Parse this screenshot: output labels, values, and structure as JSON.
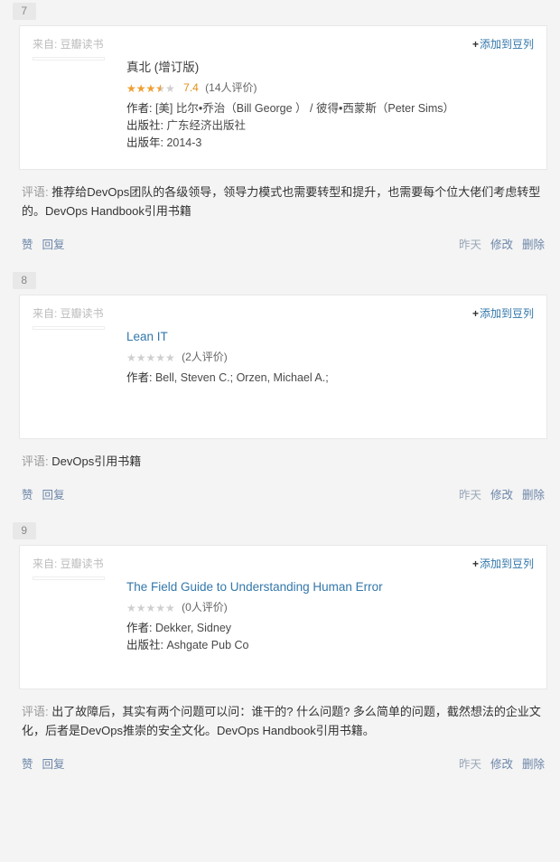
{
  "page": {
    "background": "#f4f4f4",
    "card_background": "#ffffff",
    "link_color": "#3377aa",
    "action_link_color": "#6b85a8",
    "rating_color": "#e09015",
    "star_filled_color": "#f0a030",
    "star_empty_color": "#cfcfcf"
  },
  "labels": {
    "source_prefix": "来自:",
    "source_site": "豆瓣读书",
    "add_to_doulist": "添加到豆列",
    "add_plus": "+",
    "author_key": "作者:",
    "publisher_key": "出版社:",
    "pubdate_key": "出版年:",
    "comment_label": "评语:",
    "like": "赞",
    "reply": "回复",
    "edit": "修改",
    "delete": "删除"
  },
  "entries": [
    {
      "index": "7",
      "source_prefix": "来自:",
      "source_site": "豆瓣读书",
      "add_to_doulist": "添加到豆列",
      "cover_art": "zhenbei",
      "cover_alt": "真北 (增订版) 书封面",
      "title": "真北 (增订版)",
      "title_is_chinese": true,
      "stars_filled": 3.5,
      "stars_total": 5,
      "stars_glyphs": "★★★★★",
      "rating_value": "7.4",
      "rating_count": "(14人评价)",
      "fields": [
        {
          "key": "作者:",
          "value": "[美] 比尔•乔治（Bill George ） / 彼得•西蒙斯（Peter Sims）"
        },
        {
          "key": "出版社:",
          "value": "广东经济出版社"
        },
        {
          "key": "出版年:",
          "value": "2014-3"
        }
      ],
      "comment_label": "评语:",
      "comment_text": "推荐给DevOps团队的各级领导，领导力模式也需要转型和提升，也需要每个位大佬们考虑转型的。DevOps Handbook引用书籍",
      "like": "赞",
      "reply": "回复",
      "time": "昨天",
      "edit": "修改",
      "delete": "删除"
    },
    {
      "index": "8",
      "source_prefix": "来自:",
      "source_site": "豆瓣读书",
      "add_to_doulist": "添加到豆列",
      "cover_art": "lean",
      "cover_alt": "Lean IT 书封面",
      "title": "Lean IT",
      "title_is_chinese": false,
      "stars_filled": 0,
      "stars_total": 5,
      "stars_glyphs": "★★★★★",
      "rating_value": "",
      "rating_count": "(2人评价)",
      "fields": [
        {
          "key": "作者:",
          "value": "Bell, Steven C.; Orzen, Michael A.;"
        }
      ],
      "comment_label": "评语:",
      "comment_text": "DevOps引用书籍",
      "like": "赞",
      "reply": "回复",
      "time": "昨天",
      "edit": "修改",
      "delete": "删除"
    },
    {
      "index": "9",
      "source_prefix": "来自:",
      "source_site": "豆瓣读书",
      "add_to_doulist": "添加到豆列",
      "cover_art": "field",
      "cover_alt": "The Field Guide to Understanding Human Error 书封面",
      "title": "The Field Guide to Understanding Human Error",
      "title_is_chinese": false,
      "stars_filled": 0,
      "stars_total": 5,
      "stars_glyphs": "★★★★★",
      "rating_value": "",
      "rating_count": "(0人评价)",
      "fields": [
        {
          "key": "作者:",
          "value": "Dekker, Sidney"
        },
        {
          "key": "出版社:",
          "value": "Ashgate Pub Co"
        }
      ],
      "comment_label": "评语:",
      "comment_text": "出了故障后，其实有两个问题可以问：谁干的? 什么问题? 多么简单的问题，截然想法的企业文化，后者是DevOps推崇的安全文化。DevOps Handbook引用书籍。",
      "like": "赞",
      "reply": "回复",
      "time": "昨天",
      "edit": "修改",
      "delete": "删除"
    }
  ]
}
